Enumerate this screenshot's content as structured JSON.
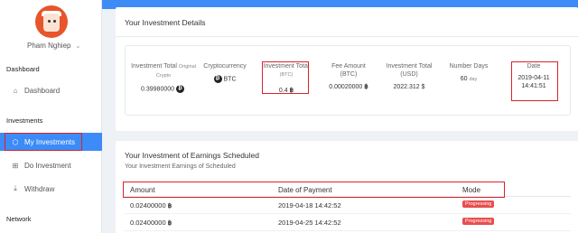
{
  "user": {
    "name": "Pham Nghiep"
  },
  "sidebar": {
    "sections": [
      {
        "title": "Dashboard",
        "items": [
          {
            "label": "Dashboard",
            "icon": "home-icon"
          }
        ]
      },
      {
        "title": "Investments",
        "items": [
          {
            "label": "My Investments",
            "icon": "cube-icon",
            "active": true
          },
          {
            "label": "Do Investment",
            "icon": "plus-square-icon"
          },
          {
            "label": "Withdraw",
            "icon": "download-icon"
          }
        ]
      },
      {
        "title": "Network",
        "items": []
      }
    ]
  },
  "details": {
    "title": "Your Investment Details",
    "investment_total": {
      "label": "Investment Total",
      "label_small": "Original Crypto",
      "value": "0.39980000"
    },
    "cryptocurrency": {
      "label": "Cryptocurrency",
      "value": "BTC"
    },
    "investment_total_btc": {
      "label": "Investment Total",
      "label_small": "(BTC)",
      "value": "0.4"
    },
    "fee_amount": {
      "label": "Fee Amount (BTC)",
      "value": "0.00020000"
    },
    "investment_total_usd": {
      "label": "Investment Total (USD)",
      "value": "2022.312 $"
    },
    "number_days": {
      "label": "Number Days",
      "value": "60",
      "unit": "day"
    },
    "date": {
      "label": "Date",
      "value_date": "2019-04-11",
      "value_time": "14:41:51"
    }
  },
  "earnings": {
    "title": "Your Investment of Earnings Scheduled",
    "subtitle": "Your Investment Earnings of Scheduled",
    "columns": {
      "amount": "Amount",
      "date": "Date of Payment",
      "mode": "Mode"
    },
    "rows": [
      {
        "amount": "0.02400000",
        "date": "2019-04-18 14:42:52",
        "mode": "Progressing"
      },
      {
        "amount": "0.02400000",
        "date": "2019-04-25 14:42:52",
        "mode": "Progressing"
      }
    ]
  },
  "symbols": {
    "bitcoin": "฿",
    "chevron": "⌄"
  },
  "colors": {
    "accent": "#3d8bf7",
    "highlight": "#d9232d",
    "badge": "#e84d4d",
    "avatar": "#e8542b"
  }
}
